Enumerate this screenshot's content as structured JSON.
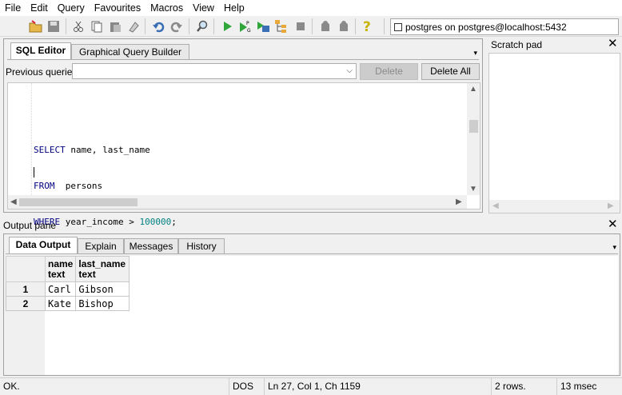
{
  "menu": [
    "File",
    "Edit",
    "Query",
    "Favourites",
    "Macros",
    "View",
    "Help"
  ],
  "connection": "postgres on postgres@localhost:5432",
  "editor_tabs": [
    "SQL Editor",
    "Graphical Query Builder"
  ],
  "previous_queries_label": "Previous queries",
  "delete_label": "Delete",
  "delete_all_label": "Delete All",
  "sql": {
    "line1_kw": "SELECT",
    "line1_rest": " name, last_name",
    "line2_kw": "FROM",
    "line2_rest": "  persons",
    "line3_kw": "WHERE",
    "line3_rest": " year_income > ",
    "line3_num": "100000",
    "line3_end": ";"
  },
  "scratch_pad_title": "Scratch pad",
  "output_pane_title": "Output pane",
  "output_tabs": [
    "Data Output",
    "Explain",
    "Messages",
    "History"
  ],
  "columns": [
    {
      "name": "name",
      "type": "text"
    },
    {
      "name": "last_name",
      "type": "text"
    }
  ],
  "rows": [
    {
      "num": "1",
      "name": "Carl",
      "last_name": "Gibson"
    },
    {
      "num": "2",
      "name": "Kate",
      "last_name": "Bishop"
    }
  ],
  "status": {
    "message": "OK.",
    "encoding": "DOS",
    "position": "Ln 27, Col 1, Ch 1159",
    "rows": "2 rows.",
    "time": "13 msec"
  }
}
